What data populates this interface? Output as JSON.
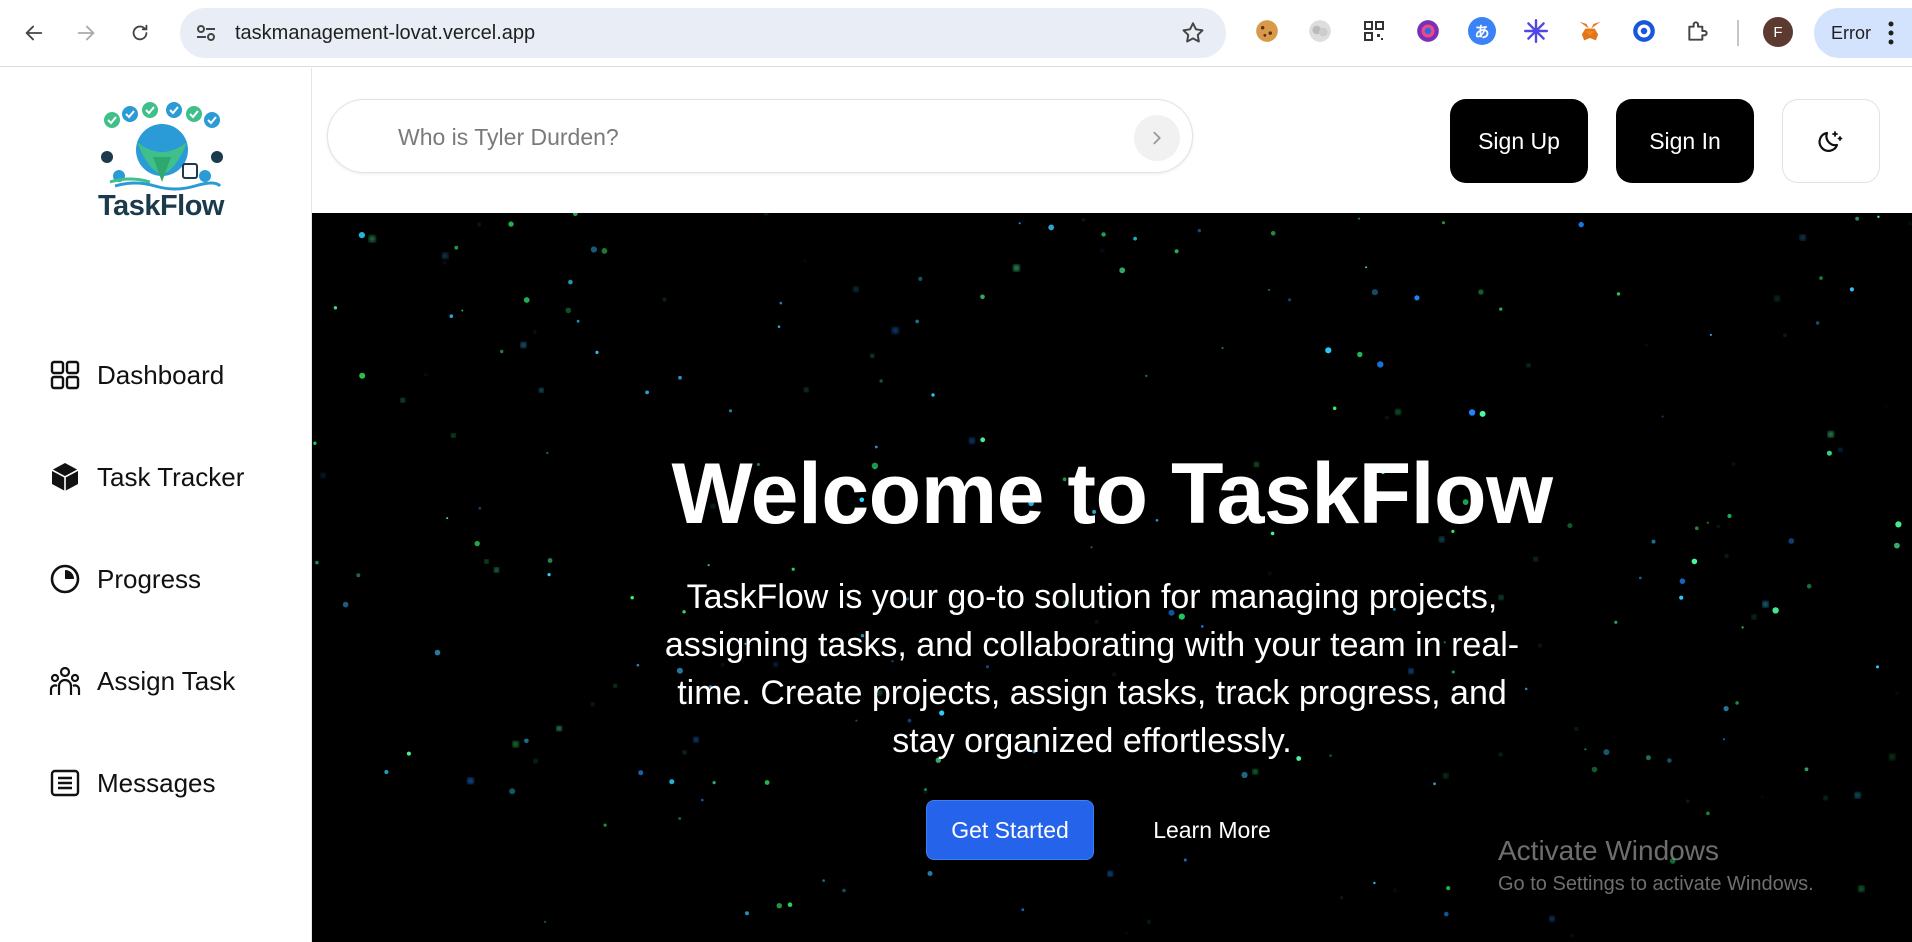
{
  "browser": {
    "url": "taskmanagement-lovat.vercel.app",
    "profile_initial": "F",
    "error_label": "Error"
  },
  "sidebar": {
    "logo_text": "TaskFlow",
    "items": [
      {
        "label": "Dashboard",
        "icon": "grid-icon"
      },
      {
        "label": "Task Tracker",
        "icon": "cube-icon"
      },
      {
        "label": "Progress",
        "icon": "pie-chart-icon"
      },
      {
        "label": "Assign Task",
        "icon": "users-icon"
      },
      {
        "label": "Messages",
        "icon": "list-icon"
      }
    ]
  },
  "header": {
    "search_placeholder": "Who is Tyler Durden?",
    "signup_label": "Sign Up",
    "signin_label": "Sign In"
  },
  "hero": {
    "title": "Welcome to TaskFlow",
    "description": "TaskFlow is your go-to solution for managing projects, assigning tasks, and collaborating with your team in real-time. Create projects, assign tasks, track progress, and stay organized effortlessly.",
    "primary_label": "Get Started",
    "secondary_label": "Learn More"
  },
  "watermark": {
    "line1": "Activate Windows",
    "line2": "Go to Settings to activate Windows."
  },
  "colors": {
    "primary": "#2563eb",
    "dark_button": "#000000",
    "hero_bg": "#000000"
  }
}
